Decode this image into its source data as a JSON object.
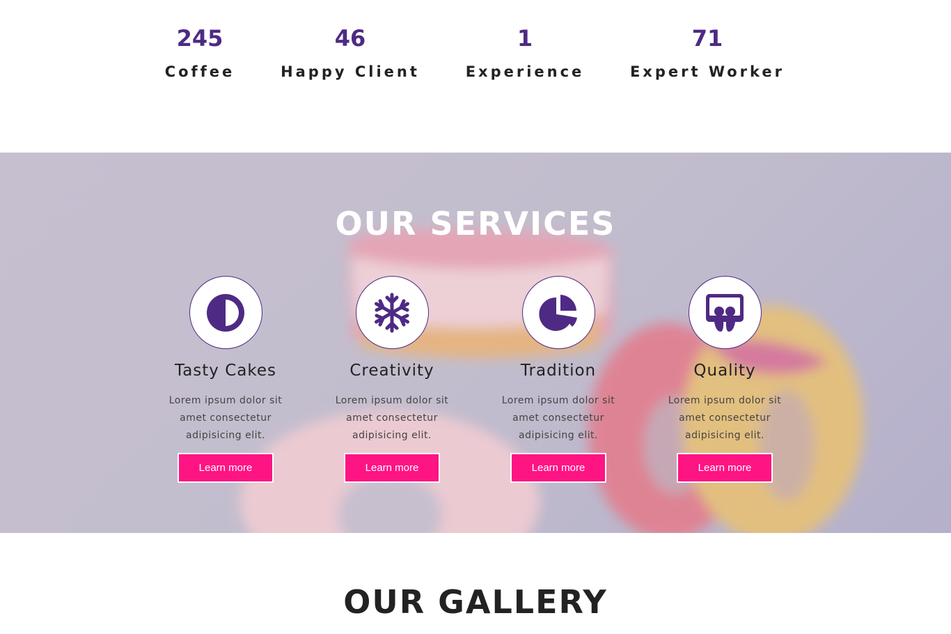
{
  "stats": [
    {
      "number": "245",
      "label": "Coffee"
    },
    {
      "number": "46",
      "label": "Happy Client"
    },
    {
      "number": "1",
      "label": "Experience"
    },
    {
      "number": "71",
      "label": "Expert Worker"
    }
  ],
  "services": {
    "title": "OUR SERVICES",
    "items": [
      {
        "icon": "adjust-icon",
        "title": "Tasty Cakes",
        "text": "Lorem ipsum dolor sit amet consectetur adipisicing elit.",
        "button": "Learn more"
      },
      {
        "icon": "snowflake-icon",
        "title": "Creativity",
        "text": "Lorem ipsum dolor sit amet consectetur adipisicing elit.",
        "button": "Learn more"
      },
      {
        "icon": "pie-chart-icon",
        "title": "Tradition",
        "text": "Lorem ipsum dolor sit amet consectetur adipisicing elit.",
        "button": "Learn more"
      },
      {
        "icon": "slideshare-icon",
        "title": "Quality",
        "text": "Lorem ipsum dolor sit amet consectetur adipisicing elit.",
        "button": "Learn more"
      }
    ]
  },
  "gallery": {
    "title": "OUR GALLERY"
  },
  "colors": {
    "accent": "#4e2a84",
    "button": "#ff1484",
    "heading": "#222222"
  }
}
